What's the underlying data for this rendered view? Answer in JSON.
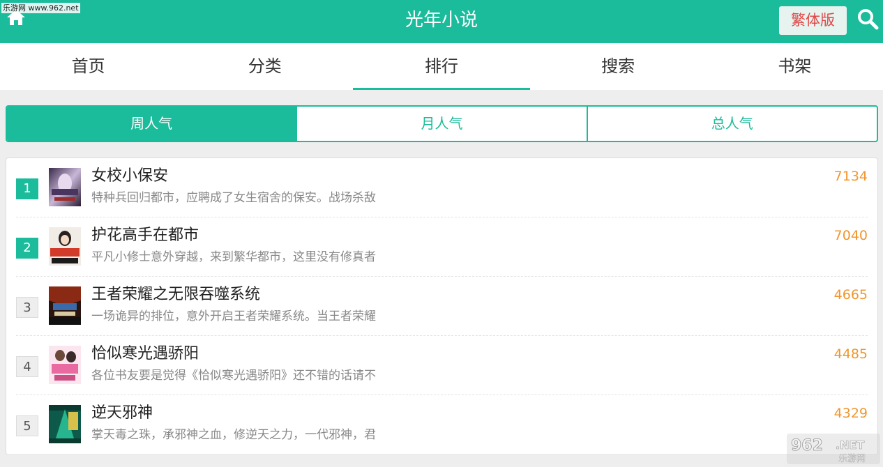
{
  "watermark": {
    "top_text": "乐游网 www.962.net",
    "corner_brand": "962",
    "corner_domain": ".NET",
    "corner_sub": "乐游网"
  },
  "header": {
    "title": "光年小说",
    "trad_button": "繁体版"
  },
  "nav": {
    "tabs": [
      "首页",
      "分类",
      "排行",
      "搜索",
      "书架"
    ],
    "active": "排行"
  },
  "segment": {
    "items": [
      "周人气",
      "月人气",
      "总人气"
    ],
    "active": "周人气"
  },
  "ranking": [
    {
      "rank": "1",
      "title": "女校小保安",
      "desc": "特种兵回归都市，应聘成了女生宿舍的保安。战场杀敌",
      "count": "7134"
    },
    {
      "rank": "2",
      "title": "护花高手在都市",
      "desc": "平凡小修士意外穿越，来到繁华都市，这里没有修真者",
      "count": "7040"
    },
    {
      "rank": "3",
      "title": "王者荣耀之无限吞噬系统",
      "desc": "一场诡异的排位，意外开启王者荣耀系统。当王者荣耀",
      "count": "4665"
    },
    {
      "rank": "4",
      "title": "恰似寒光遇骄阳",
      "desc": "各位书友要是觉得《恰似寒光遇骄阳》还不错的话请不",
      "count": "4485"
    },
    {
      "rank": "5",
      "title": "逆天邪神",
      "desc": "掌天毒之珠，承邪神之血，修逆天之力，一代邪神，君",
      "count": "4329"
    }
  ],
  "colors": {
    "accent": "#1bbc9b",
    "count": "#f0962d",
    "trad_text": "#e04848"
  }
}
